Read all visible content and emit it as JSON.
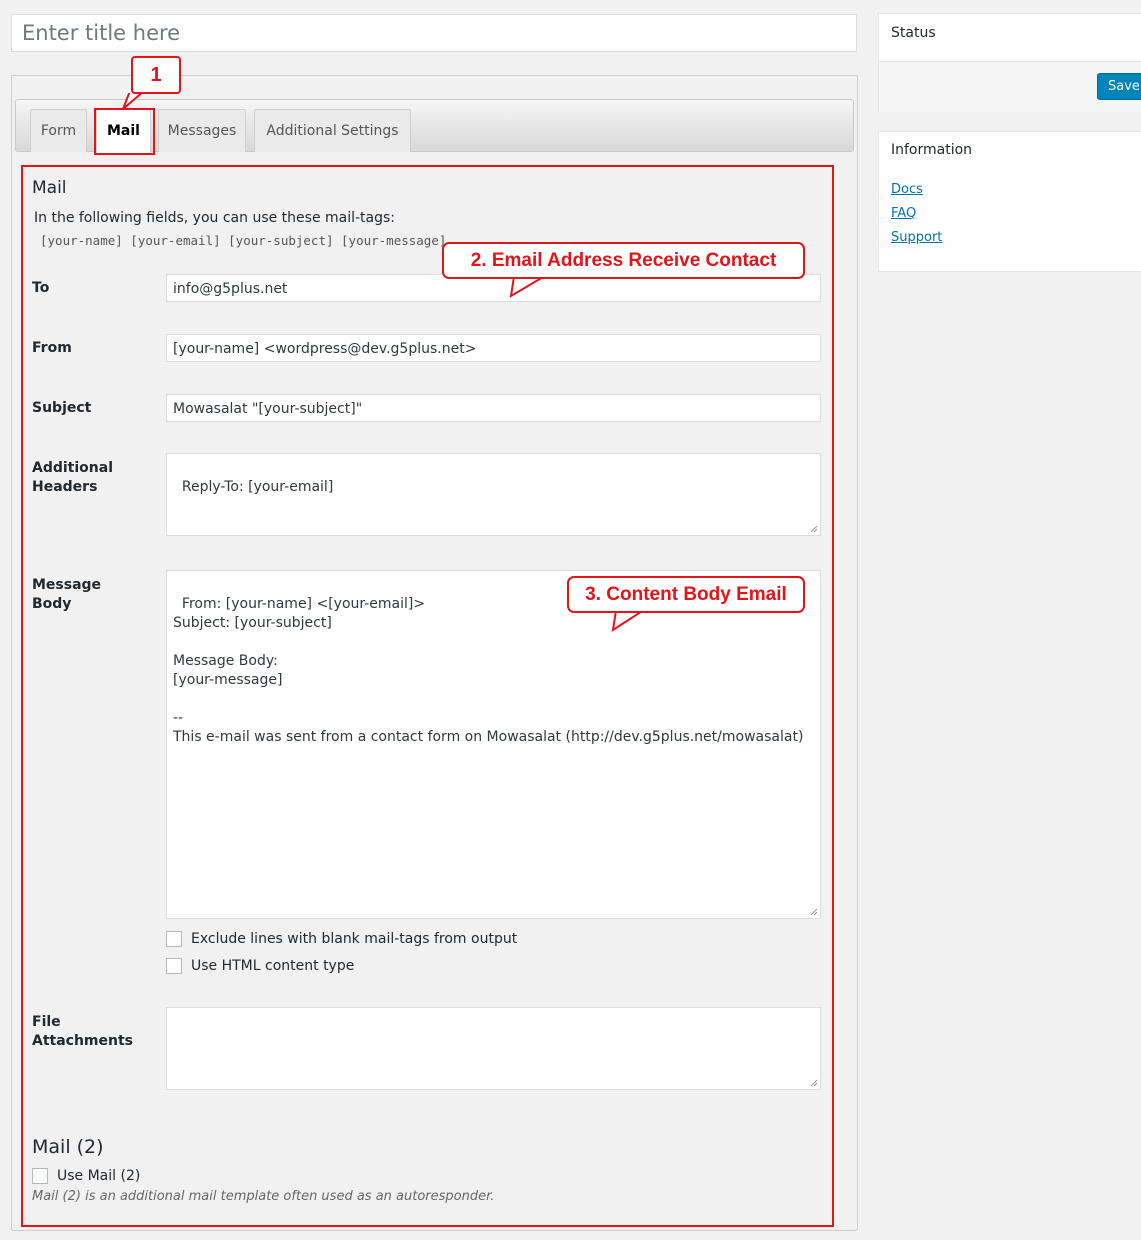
{
  "title_input": {
    "placeholder": "Enter title here"
  },
  "tabs": [
    {
      "label": "Form"
    },
    {
      "label": "Mail"
    },
    {
      "label": "Messages"
    },
    {
      "label": "Additional Settings"
    }
  ],
  "annotations": {
    "step1": "1",
    "step2": "2. Email Address Receive Contact",
    "step3": "3. Content Body Email"
  },
  "mail": {
    "heading": "Mail",
    "note": "In the following fields, you can use these mail-tags:",
    "tags": "[your-name] [your-email] [your-subject] [your-message]",
    "to_label": "To",
    "to_value": "info@g5plus.net",
    "from_label": "From",
    "from_value": "[your-name] <wordpress@dev.g5plus.net>",
    "subject_label": "Subject",
    "subject_value": "Mowasalat \"[your-subject]\"",
    "headers_label_1": "Additional",
    "headers_label_2": "Headers",
    "headers_value": "Reply-To: [your-email]",
    "body_label_1": "Message",
    "body_label_2": "Body",
    "body_value": "From: [your-name] <[your-email]>\nSubject: [your-subject]\n\nMessage Body:\n[your-message]\n\n--\nThis e-mail was sent from a contact form on Mowasalat (http://dev.g5plus.net/mowasalat)",
    "exclude_blank_label": "Exclude lines with blank mail-tags from output",
    "use_html_label": "Use HTML content type",
    "attach_label_1": "File",
    "attach_label_2": "Attachments",
    "attach_value": ""
  },
  "mail2": {
    "heading": "Mail (2)",
    "use_label": "Use Mail (2)",
    "description": "Mail (2) is an additional mail template often used as an autoresponder."
  },
  "sidebar": {
    "status_title": "Status",
    "save_label": "Save",
    "info_title": "Information",
    "links": [
      "Docs",
      "FAQ",
      "Support"
    ]
  },
  "colors": {
    "annotation_red": "#e3141a",
    "link_blue": "#0073aa",
    "button_blue": "#0085ba"
  }
}
